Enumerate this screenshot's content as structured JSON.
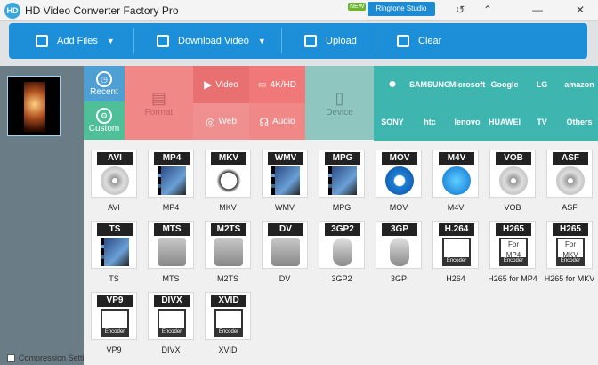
{
  "window": {
    "title": "HD Video Converter Factory Pro",
    "logo_text": "HD",
    "new_badge": "NEW",
    "ringtone_button": "Ringtone Studio",
    "controls": {
      "refresh": "↺",
      "settings": "⌃",
      "minimize": "—",
      "close": "✕"
    }
  },
  "toolbar": {
    "add_files": "Add Files",
    "download_video": "Download Video",
    "upload": "Upload",
    "clear": "Clear"
  },
  "categories": {
    "recent": "Recent",
    "custom": "Custom",
    "format": "Format",
    "video": "Video",
    "web": "Web",
    "k4hd": "4K/HD",
    "audio": "Audio",
    "device": "Device"
  },
  "brands": [
    "",
    "SAMSUNG",
    "Microsoft",
    "Google",
    "LG",
    "amazon",
    "SONY",
    "htc",
    "lenovo",
    "HUAWEI",
    "TV",
    "Others"
  ],
  "formats": [
    {
      "tag": "AVI",
      "label": "AVI",
      "art": "disc"
    },
    {
      "tag": "MP4",
      "label": "MP4",
      "art": "film"
    },
    {
      "tag": "MKV",
      "label": "MKV",
      "art": "mkv"
    },
    {
      "tag": "WMV",
      "label": "WMV",
      "art": "film"
    },
    {
      "tag": "MPG",
      "label": "MPG",
      "art": "film"
    },
    {
      "tag": "MOV",
      "label": "MOV",
      "art": "qt"
    },
    {
      "tag": "M4V",
      "label": "M4V",
      "art": "itunes"
    },
    {
      "tag": "VOB",
      "label": "VOB",
      "art": "disc"
    },
    {
      "tag": "ASF",
      "label": "ASF",
      "art": "disc"
    },
    {
      "tag": "TS",
      "label": "TS",
      "art": "film"
    },
    {
      "tag": "MTS",
      "label": "MTS",
      "art": "cam"
    },
    {
      "tag": "M2TS",
      "label": "M2TS",
      "art": "cam"
    },
    {
      "tag": "DV",
      "label": "DV",
      "art": "cam"
    },
    {
      "tag": "3GP2",
      "label": "3GP2",
      "art": "phone"
    },
    {
      "tag": "3GP",
      "label": "3GP",
      "art": "phone"
    },
    {
      "tag": "H.264",
      "label": "H264",
      "art": "enc"
    },
    {
      "tag": "H265",
      "label": "H265 for MP4",
      "art": "enc",
      "sub": "For MP4"
    },
    {
      "tag": "H265",
      "label": "H265 for MKV",
      "art": "enc",
      "sub": "For MKV"
    },
    {
      "tag": "VP9",
      "label": "VP9",
      "art": "enc"
    },
    {
      "tag": "DIVX",
      "label": "DIVX",
      "art": "enc"
    },
    {
      "tag": "XVID",
      "label": "XVID",
      "art": "enc"
    }
  ],
  "compression": "Compression Settings"
}
